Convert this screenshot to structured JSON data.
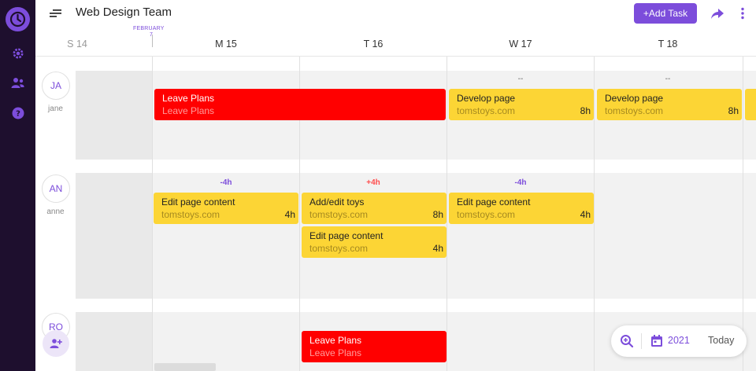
{
  "header": {
    "title": "Web Design Team",
    "add_task_label": "+Add Task"
  },
  "timeline": {
    "month_label": "FEBRUARY",
    "month_day": "7",
    "days": [
      "S 14",
      "M 15",
      "T 16",
      "W 17",
      "T 18"
    ]
  },
  "members": [
    {
      "initials": "JA",
      "name": "jane",
      "notes": [
        "",
        "",
        "--",
        "--"
      ],
      "tasks": [
        {
          "title": "Leave Plans",
          "subtitle": "Leave Plans",
          "hours": "",
          "color": "#ff0000"
        },
        {
          "title": "Develop page",
          "subtitle": "tomstoys.com",
          "hours": "8h",
          "color": "#fcd535"
        },
        {
          "title": "Develop page",
          "subtitle": "tomstoys.com",
          "hours": "8h",
          "color": "#fcd535"
        }
      ]
    },
    {
      "initials": "AN",
      "name": "anne",
      "notes": [
        "-4h",
        "+4h",
        "-4h",
        ""
      ],
      "tasks": [
        {
          "title": "Edit page content",
          "subtitle": "tomstoys.com",
          "hours": "4h",
          "color": "#fcd535"
        },
        {
          "title": "Add/edit toys",
          "subtitle": "tomstoys.com",
          "hours": "8h",
          "color": "#fcd535"
        },
        {
          "title": "Edit page content",
          "subtitle": "tomstoys.com",
          "hours": "4h",
          "color": "#fcd535"
        },
        {
          "title": "Edit page content",
          "subtitle": "tomstoys.com",
          "hours": "4h",
          "color": "#fcd535"
        }
      ]
    },
    {
      "initials": "RO",
      "name": "",
      "tasks": [
        {
          "title": "Leave Plans",
          "subtitle": "Leave Plans",
          "hours": "",
          "color": "#ff0000"
        }
      ]
    }
  ],
  "zoom_bar": {
    "year": "2021",
    "today_label": "Today"
  },
  "colors": {
    "accent": "#7c4ddb",
    "sidebar": "#1e0f2e",
    "task_yellow": "#fcd535",
    "task_red": "#ff0000"
  },
  "icons": {
    "sidebar": [
      "app-logo-icon",
      "gear-icon",
      "team-icon",
      "help-icon"
    ],
    "header": [
      "menu-icon",
      "share-icon",
      "more-vertical-icon"
    ],
    "zoom_bar": [
      "zoom-in-icon",
      "calendar-icon"
    ],
    "add_member": "add-user-icon"
  }
}
